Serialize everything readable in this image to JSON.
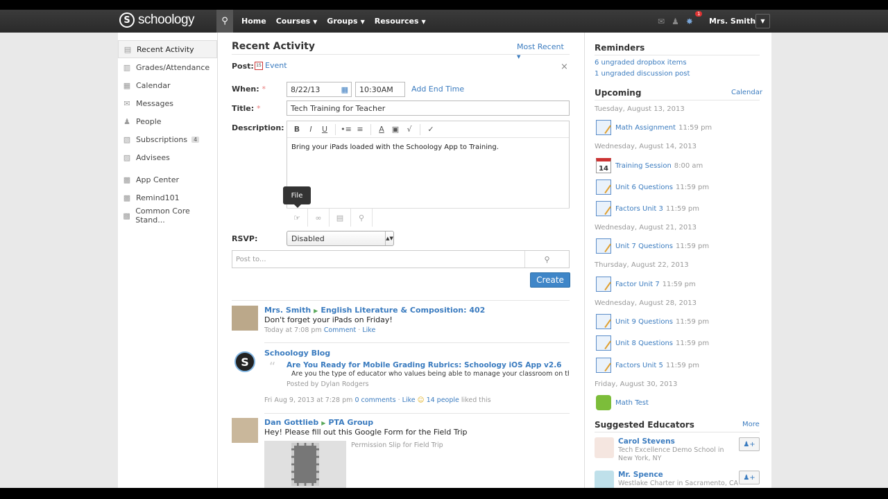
{
  "nav": {
    "logo_text": "schoology",
    "menu": [
      "Home",
      "Courses",
      "Groups",
      "Resources"
    ],
    "notifications_count": "1",
    "user_name": "Mrs. Smith"
  },
  "sidebar": {
    "items": [
      {
        "label": "Recent Activity",
        "icon": "activity-icon"
      },
      {
        "label": "Grades/Attendance",
        "icon": "grades-icon"
      },
      {
        "label": "Calendar",
        "icon": "calendar-icon"
      },
      {
        "label": "Messages",
        "icon": "messages-icon"
      },
      {
        "label": "People",
        "icon": "people-icon"
      },
      {
        "label": "Subscriptions",
        "icon": "subscriptions-icon",
        "count": "4"
      },
      {
        "label": "Advisees",
        "icon": "advisees-icon"
      },
      {
        "label": "App Center",
        "icon": "app-center-icon"
      },
      {
        "label": "Remind101",
        "icon": "remind-icon"
      },
      {
        "label": "Common Core Stand...",
        "icon": "common-core-icon"
      }
    ]
  },
  "main": {
    "title": "Recent Activity",
    "sort": "Most Recent",
    "post_label": "Post:",
    "post_type": "Event",
    "when_label": "When:",
    "date": "8/22/13",
    "time": "10:30AM",
    "add_end_time": "Add End Time",
    "title_label": "Title:",
    "title_value": "Tech Training for Teacher",
    "description_label": "Description:",
    "description_value": "Bring your iPads loaded with the Schoology App to Training.",
    "tooltip": "File",
    "rsvp_label": "RSVP:",
    "rsvp_value": "Disabled",
    "post_to_placeholder": "Post to...",
    "create_label": "Create"
  },
  "feed": [
    {
      "author": "Mrs. Smith",
      "target": "English Literature & Composition: 402",
      "body": "Don't forget your iPads on Friday!",
      "time": "Today at 7:08 pm",
      "comment": "Comment",
      "like": "Like"
    },
    {
      "author": "Schoology Blog",
      "headline": "Are You Ready for Mobile Grading Rubrics: Schoology iOS App v2.6",
      "excerpt": "Are you the type of educator who values being able to manage your classroom on the...",
      "posted_by": "Posted by Dylan Rodgers",
      "time": "Fri Aug 9, 2013 at 7:28 pm",
      "comments": "0 comments",
      "like": "Like",
      "likes": "14 people",
      "liked_this": "liked this"
    },
    {
      "author": "Dan Gottlieb",
      "target": "PTA Group",
      "body": "Hey! Please fill out this Google Form for the Field Trip",
      "attachment": "Permission Slip for Field Trip"
    }
  ],
  "reminders": {
    "title": "Reminders",
    "items": [
      "6 ungraded dropbox items",
      "1 ungraded discussion post"
    ]
  },
  "upcoming": {
    "title": "Upcoming",
    "calendar_link": "Calendar",
    "groups": [
      {
        "date": "Tuesday, August 13, 2013",
        "events": [
          {
            "name": "Math Assignment",
            "time": "11:59 pm",
            "icon": "assignment-icon"
          }
        ]
      },
      {
        "date": "Wednesday, August 14, 2013",
        "events": [
          {
            "name": "Training Session",
            "time": "8:00 am",
            "icon": "calendar-event-icon",
            "day": "14"
          },
          {
            "name": "Unit 6 Questions",
            "time": "11:59 pm",
            "icon": "assignment-icon"
          },
          {
            "name": "Factors Unit 3",
            "time": "11:59 pm",
            "icon": "assignment-icon"
          }
        ]
      },
      {
        "date": "Wednesday, August 21, 2013",
        "events": [
          {
            "name": "Unit 7 Questions",
            "time": "11:59 pm",
            "icon": "assignment-icon"
          }
        ]
      },
      {
        "date": "Thursday, August 22, 2013",
        "events": [
          {
            "name": "Factor Unit 7",
            "time": "11:59 pm",
            "icon": "assignment-icon"
          }
        ]
      },
      {
        "date": "Wednesday, August 28, 2013",
        "events": [
          {
            "name": "Unit 9 Questions",
            "time": "11:59 pm",
            "icon": "assignment-icon"
          },
          {
            "name": "Unit 8 Questions",
            "time": "11:59 pm",
            "icon": "assignment-icon"
          },
          {
            "name": "Factors Unit 5",
            "time": "11:59 pm",
            "icon": "assignment-icon"
          }
        ]
      },
      {
        "date": "Friday, August 30, 2013",
        "events": [
          {
            "name": "Math Test",
            "time": "",
            "icon": "test-icon"
          }
        ]
      }
    ]
  },
  "suggested": {
    "title": "Suggested Educators",
    "more": "More",
    "people": [
      {
        "name": "Carol Stevens",
        "school": "Tech Excellence Demo School in New York, NY"
      },
      {
        "name": "Mr. Spence",
        "school": "Westlake Charter in Sacramento, CA"
      }
    ]
  }
}
